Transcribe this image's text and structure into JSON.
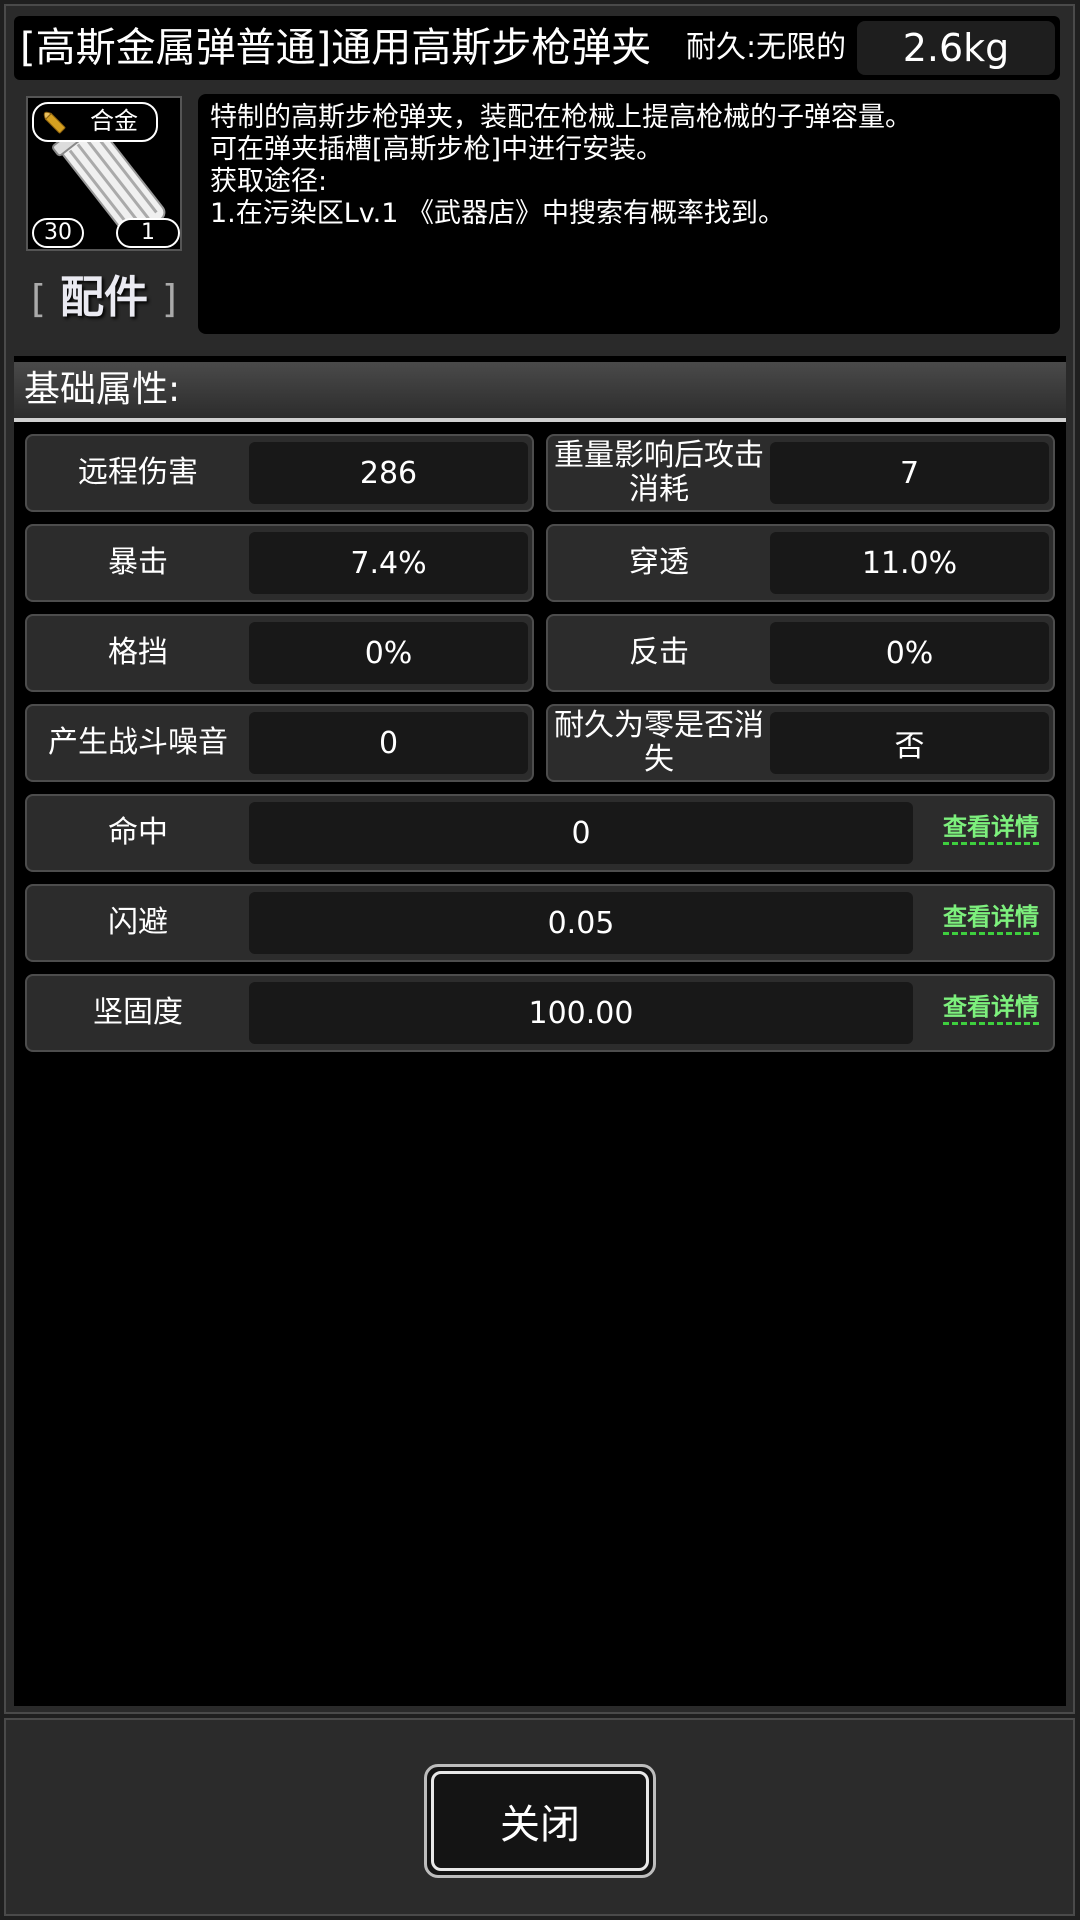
{
  "header": {
    "item_name": "[高斯金属弹普通]通用高斯步枪弹夹",
    "durability_label": "耐久:无限的",
    "weight": "2.6kg"
  },
  "item_icon": {
    "material": "合金",
    "level": "30",
    "count": "1",
    "icon": "magazine-icon",
    "badge_icon": "bullet-icon"
  },
  "category": {
    "open": "[",
    "label": "配件",
    "close": "]"
  },
  "description": {
    "lines": [
      "特制的高斯步枪弹夹，装配在枪械上提高枪械的子弹容量。",
      "可在弹夹插槽[高斯步枪]中进行安装。",
      "获取途径:",
      "1.在污染区Lv.1 《武器店》中搜索有概率找到。"
    ]
  },
  "attributes": {
    "section_title": "基础属性:",
    "grid": [
      {
        "label": "远程伤害",
        "value": "286"
      },
      {
        "label": "重量影响后攻击消耗",
        "value": "7"
      },
      {
        "label": "暴击",
        "value": "7.4%"
      },
      {
        "label": "穿透",
        "value": "11.0%"
      },
      {
        "label": "格挡",
        "value": "0%"
      },
      {
        "label": "反击",
        "value": "0%"
      },
      {
        "label": "产生战斗噪音",
        "value": "0"
      },
      {
        "label": "耐久为零是否消失",
        "value": "否"
      }
    ],
    "wide": [
      {
        "label": "命中",
        "value": "0",
        "link": "查看详情"
      },
      {
        "label": "闪避",
        "value": "0.05",
        "link": "查看详情"
      },
      {
        "label": "坚固度",
        "value": "100.00",
        "link": "查看详情"
      }
    ]
  },
  "footer": {
    "close_label": "关闭"
  },
  "colors": {
    "link_green": "#7df07d",
    "panel_bg": "#2c2c2c"
  }
}
